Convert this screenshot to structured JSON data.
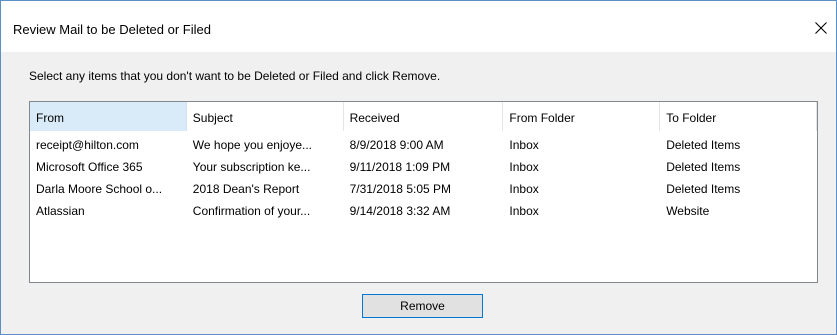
{
  "dialog": {
    "title": "Review Mail to be Deleted or Filed",
    "close_icon": "close-icon",
    "instruction": "Select any items that you don't want to be Deleted or Filed and click Remove.",
    "accent_color": "#0078d7"
  },
  "list": {
    "columns": [
      "From",
      "Subject",
      "Received",
      "From Folder",
      "To Folder"
    ],
    "active_column": "From",
    "rows": [
      [
        "receipt@hilton.com",
        "We hope you enjoye...",
        "8/9/2018 9:00 AM",
        "Inbox",
        "Deleted Items"
      ],
      [
        "Microsoft Office 365",
        "Your subscription ke...",
        "9/11/2018 1:09 PM",
        "Inbox",
        "Deleted Items"
      ],
      [
        "Darla Moore School o...",
        "2018 Dean's Report",
        "7/31/2018 5:05 PM",
        "Inbox",
        "Deleted Items"
      ],
      [
        "Atlassian",
        "Confirmation of your...",
        "9/14/2018 3:32 AM",
        "Inbox",
        "Website"
      ]
    ]
  },
  "buttons": {
    "remove_label": "Remove"
  }
}
